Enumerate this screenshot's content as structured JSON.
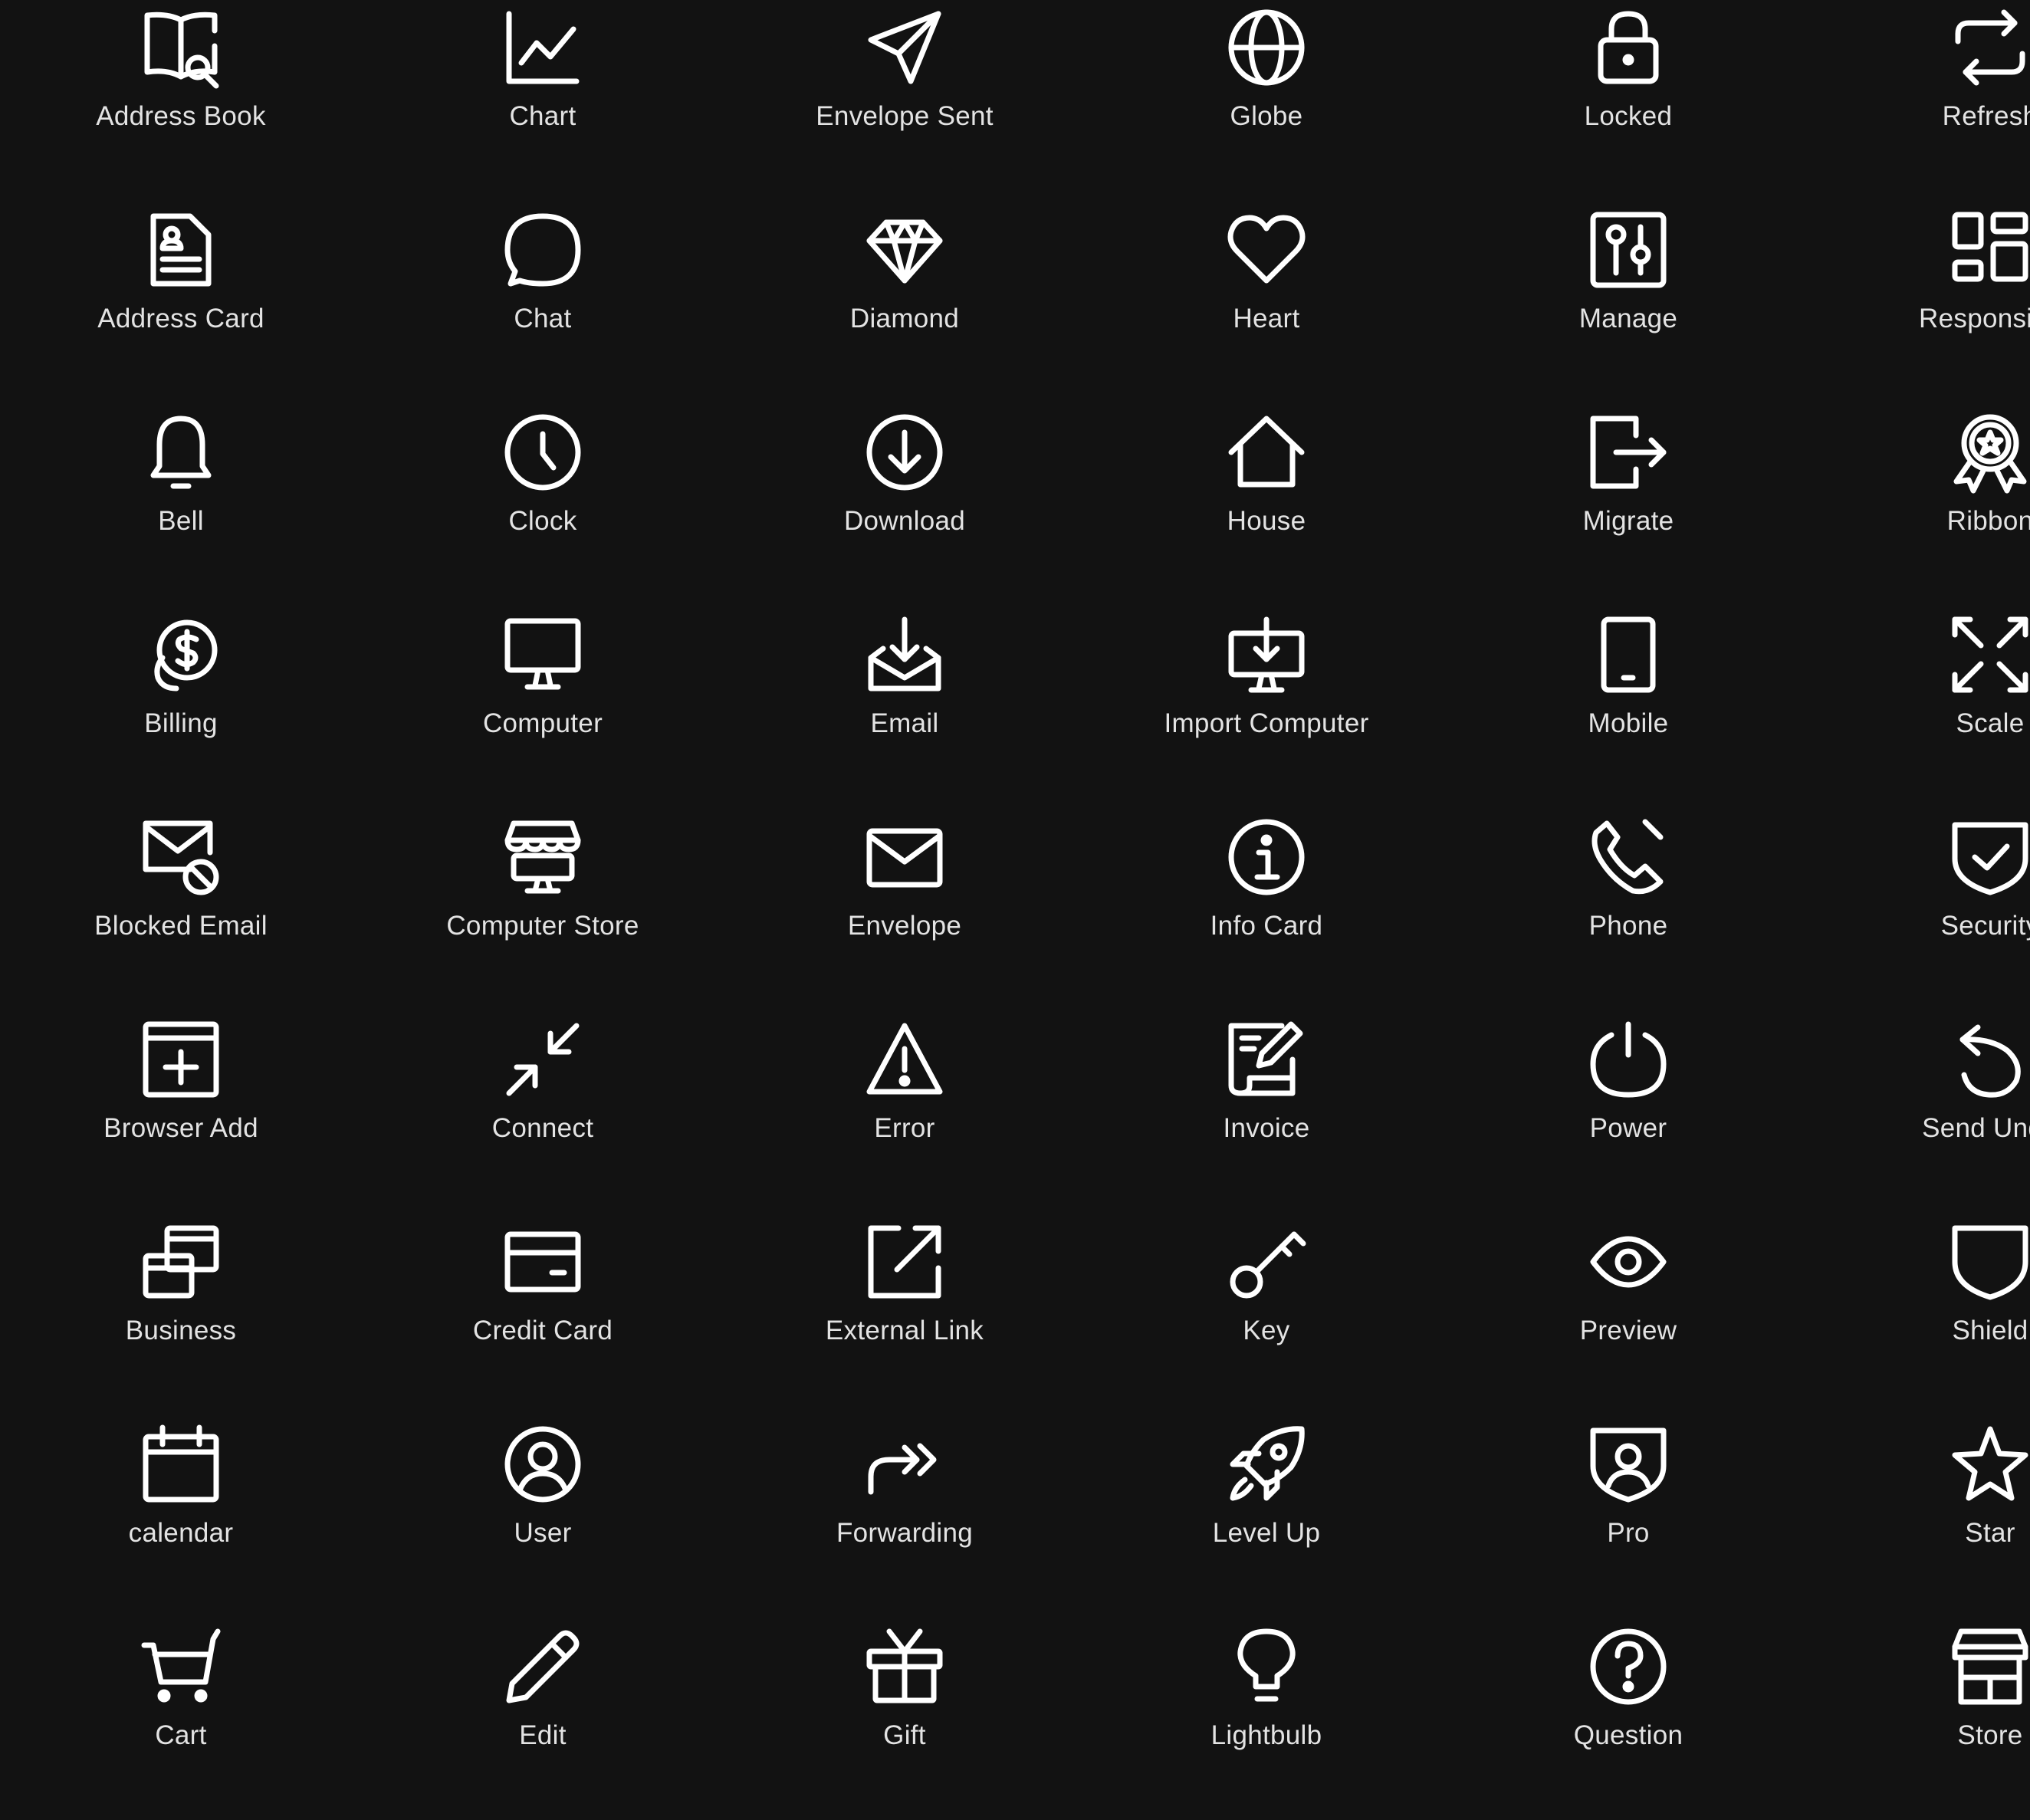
{
  "colors": {
    "background": "#121212",
    "icon": "#ffffff",
    "label": "#e3e3e3"
  },
  "icons": [
    {
      "label": "Address Book",
      "icon": "address-book-icon"
    },
    {
      "label": "Chart",
      "icon": "chart-icon"
    },
    {
      "label": "Envelope Sent",
      "icon": "envelope-sent-icon"
    },
    {
      "label": "Globe",
      "icon": "globe-icon"
    },
    {
      "label": "Locked",
      "icon": "locked-icon"
    },
    {
      "label": "Refresh",
      "icon": "refresh-icon"
    },
    {
      "label": "Address Card",
      "icon": "address-card-icon"
    },
    {
      "label": "Chat",
      "icon": "chat-icon"
    },
    {
      "label": "Diamond",
      "icon": "diamond-icon"
    },
    {
      "label": "Heart",
      "icon": "heart-icon"
    },
    {
      "label": "Manage",
      "icon": "manage-icon"
    },
    {
      "label": "Responsive",
      "icon": "responsive-icon"
    },
    {
      "label": "Bell",
      "icon": "bell-icon"
    },
    {
      "label": "Clock",
      "icon": "clock-icon"
    },
    {
      "label": "Download",
      "icon": "download-icon"
    },
    {
      "label": "House",
      "icon": "house-icon"
    },
    {
      "label": "Migrate",
      "icon": "migrate-icon"
    },
    {
      "label": "Ribbon",
      "icon": "ribbon-icon"
    },
    {
      "label": "Billing",
      "icon": "billing-icon"
    },
    {
      "label": "Computer",
      "icon": "computer-icon"
    },
    {
      "label": "Email",
      "icon": "email-icon"
    },
    {
      "label": "Import Computer",
      "icon": "import-computer-icon"
    },
    {
      "label": "Mobile",
      "icon": "mobile-icon"
    },
    {
      "label": "Scale",
      "icon": "scale-icon"
    },
    {
      "label": "Blocked Email",
      "icon": "blocked-email-icon"
    },
    {
      "label": "Computer Store",
      "icon": "computer-store-icon"
    },
    {
      "label": "Envelope",
      "icon": "envelope-icon"
    },
    {
      "label": "Info Card",
      "icon": "info-card-icon"
    },
    {
      "label": "Phone",
      "icon": "phone-icon"
    },
    {
      "label": "Security",
      "icon": "security-icon"
    },
    {
      "label": "Browser Add",
      "icon": "browser-add-icon"
    },
    {
      "label": "Connect",
      "icon": "connect-icon"
    },
    {
      "label": "Error",
      "icon": "error-icon"
    },
    {
      "label": "Invoice",
      "icon": "invoice-icon"
    },
    {
      "label": "Power",
      "icon": "power-icon"
    },
    {
      "label": "Send Undo",
      "icon": "send-undo-icon"
    },
    {
      "label": "Business",
      "icon": "business-icon"
    },
    {
      "label": "Credit Card",
      "icon": "credit-card-icon"
    },
    {
      "label": "External Link",
      "icon": "external-link-icon"
    },
    {
      "label": "Key",
      "icon": "key-icon"
    },
    {
      "label": "Preview",
      "icon": "preview-icon"
    },
    {
      "label": "Shield",
      "icon": "shield-icon"
    },
    {
      "label": "calendar",
      "icon": "calendar-icon"
    },
    {
      "label": "User",
      "icon": "user-icon"
    },
    {
      "label": "Forwarding",
      "icon": "forwarding-icon"
    },
    {
      "label": "Level Up",
      "icon": "level-up-icon"
    },
    {
      "label": "Pro",
      "icon": "pro-icon"
    },
    {
      "label": "Star",
      "icon": "star-icon"
    },
    {
      "label": "Cart",
      "icon": "cart-icon"
    },
    {
      "label": "Edit",
      "icon": "edit-icon"
    },
    {
      "label": "Gift",
      "icon": "gift-icon"
    },
    {
      "label": "Lightbulb",
      "icon": "lightbulb-icon"
    },
    {
      "label": "Question",
      "icon": "question-icon"
    },
    {
      "label": "Store",
      "icon": "store-icon"
    }
  ]
}
